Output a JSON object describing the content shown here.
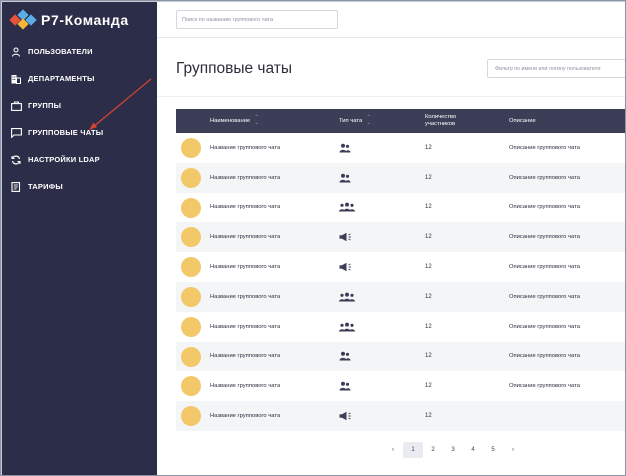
{
  "app": {
    "title": "Р7-Команда"
  },
  "sidebar": {
    "items": [
      {
        "label": "ПОЛЬЗОВАТЕЛИ",
        "icon": "user-icon"
      },
      {
        "label": "ДЕПАРТАМЕНТЫ",
        "icon": "building-icon"
      },
      {
        "label": "ГРУППЫ",
        "icon": "briefcase-icon"
      },
      {
        "label": "ГРУППОВЫЕ ЧАТЫ",
        "icon": "chat-icon"
      },
      {
        "label": "НАСТРОЙКИ LDAP",
        "icon": "sync-icon"
      },
      {
        "label": "ТАРИФЫ",
        "icon": "document-icon"
      }
    ]
  },
  "search": {
    "placeholder": "Поиск по названию группового чата"
  },
  "page": {
    "title": "Групповые чаты"
  },
  "filter": {
    "placeholder": "Фильтр по имени или логину пользователя"
  },
  "table": {
    "headers": {
      "name": "Наименование",
      "type": "Тип чата",
      "count_line1": "Количество",
      "count_line2": "участников",
      "description": "Описание"
    },
    "rows": [
      {
        "name": "Название группового чата",
        "type": "group-small-icon",
        "count": "12",
        "description": "Описание группового чата"
      },
      {
        "name": "Название группового чата",
        "type": "group-small-icon",
        "count": "12",
        "description": "Описание группового чата"
      },
      {
        "name": "Название группового чата",
        "type": "group-large-icon",
        "count": "12",
        "description": "Описание группового чата"
      },
      {
        "name": "Название группового чата",
        "type": "megaphone-icon",
        "count": "12",
        "description": "Описание группового чата"
      },
      {
        "name": "Название группового чата",
        "type": "megaphone-icon",
        "count": "12",
        "description": "Описание группового чата"
      },
      {
        "name": "Название группового чата",
        "type": "group-large-icon",
        "count": "12",
        "description": "Описание группового чата"
      },
      {
        "name": "Название группового чата",
        "type": "group-large-icon",
        "count": "12",
        "description": "Описание группового чата"
      },
      {
        "name": "Название группового чата",
        "type": "group-small-icon",
        "count": "12",
        "description": "Описание группового чата"
      },
      {
        "name": "Название группового чата",
        "type": "group-small-icon",
        "count": "12",
        "description": "Описание группового чата"
      },
      {
        "name": "Название группового чата",
        "type": "megaphone-icon",
        "count": "12",
        "description": ""
      }
    ]
  },
  "pagination": {
    "prev": "‹",
    "pages": [
      "1",
      "2",
      "3",
      "4",
      "5"
    ],
    "next": "›",
    "current": "1"
  },
  "colors": {
    "sidebar": "#2c2e49",
    "header": "#3b3e56",
    "avatar": "#f2c868",
    "arrow": "#d9432f"
  }
}
